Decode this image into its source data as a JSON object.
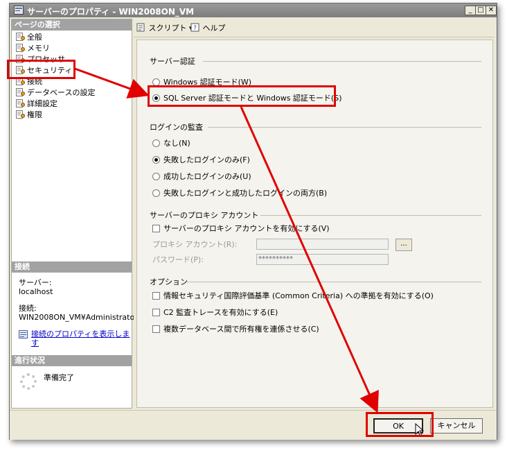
{
  "window": {
    "title": "サーバーのプロパティ - WIN2008ON_VM"
  },
  "nav": {
    "header": "ページの選択",
    "items": [
      {
        "label": "全般",
        "icon": "page-icon"
      },
      {
        "label": "メモリ",
        "icon": "page-icon"
      },
      {
        "label": "プロセッサ",
        "icon": "page-icon"
      },
      {
        "label": "セキュリティ",
        "icon": "page-icon"
      },
      {
        "label": "接続",
        "icon": "page-icon"
      },
      {
        "label": "データベースの設定",
        "icon": "page-icon"
      },
      {
        "label": "詳細設定",
        "icon": "page-icon"
      },
      {
        "label": "権限",
        "icon": "page-icon"
      }
    ]
  },
  "connection": {
    "header": "接続",
    "server_label": "サーバー:",
    "server_value": "localhost",
    "conn_label": "接続:",
    "conn_value": "WIN2008ON_VM¥Administrator",
    "link_line1": "接続のプロパティを表示しま",
    "link_line2": "す"
  },
  "progress": {
    "header": "進行状況",
    "status": "準備完了"
  },
  "toolbar": {
    "script_label": "スクリプト",
    "help_label": "ヘルプ"
  },
  "auth": {
    "title": "サーバー認証",
    "windows_mode": "Windows 認証モード(W)",
    "mixed_mode": "SQL Server 認証モードと Windows 認証モード(S)"
  },
  "audit": {
    "title": "ログインの監査",
    "none": "なし(N)",
    "failed": "失敗したログインのみ(F)",
    "success": "成功したログインのみ(U)",
    "both": "失敗したログインと成功したログインの両方(B)"
  },
  "proxy": {
    "title": "サーバーのプロキシ アカウント",
    "enable": "サーバーのプロキシ アカウントを有効にする(V)",
    "account_label": "プロキシ アカウント(R):",
    "password_label": "パスワード(P):",
    "password_value": "**********",
    "browse_label": "..."
  },
  "options": {
    "title": "オプション",
    "criteria": "情報セキュリティ国際評価基準 (Common Criteria) への準拠を有効にする(O)",
    "c2": "C2 監査トレースを有効にする(E)",
    "chaining": "複数データベース間で所有権を連係させる(C)"
  },
  "buttons": {
    "ok": "OK",
    "cancel": "キャンセル"
  },
  "colors": {
    "annotation": "#e00000"
  }
}
